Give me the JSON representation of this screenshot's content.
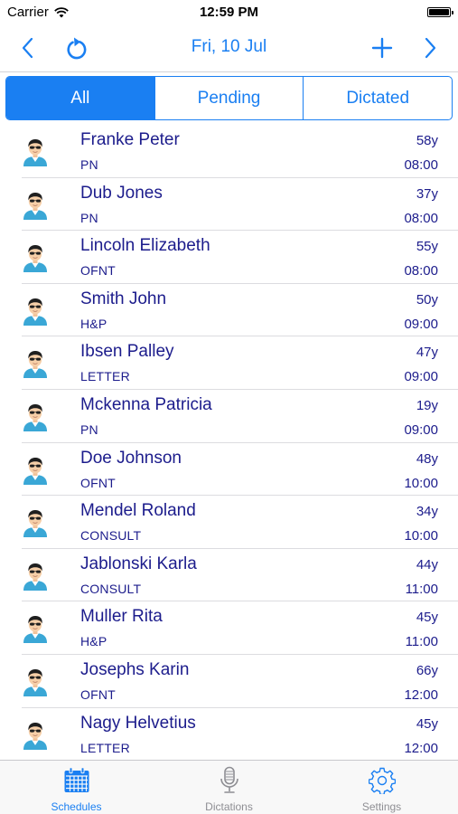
{
  "status_bar": {
    "carrier": "Carrier",
    "time": "12:59 PM"
  },
  "nav": {
    "title": "Fri, 10 Jul",
    "accent_color": "#1a7ff2"
  },
  "segments": [
    {
      "label": "All",
      "active": true
    },
    {
      "label": "Pending",
      "active": false
    },
    {
      "label": "Dictated",
      "active": false
    }
  ],
  "patients": [
    {
      "name": "Franke Peter",
      "type": "PN",
      "age": "58y",
      "time": "08:00"
    },
    {
      "name": "Dub Jones",
      "type": "PN",
      "age": "37y",
      "time": "08:00"
    },
    {
      "name": "Lincoln Elizabeth",
      "type": "OFNT",
      "age": "55y",
      "time": "08:00"
    },
    {
      "name": "Smith John",
      "type": "H&P",
      "age": "50y",
      "time": "09:00"
    },
    {
      "name": "Ibsen Palley",
      "type": "LETTER",
      "age": "47y",
      "time": "09:00"
    },
    {
      "name": "Mckenna Patricia",
      "type": "PN",
      "age": "19y",
      "time": "09:00"
    },
    {
      "name": "Doe Johnson",
      "type": "OFNT",
      "age": "48y",
      "time": "10:00"
    },
    {
      "name": "Mendel Roland",
      "type": "CONSULT",
      "age": "34y",
      "time": "10:00"
    },
    {
      "name": "Jablonski Karla",
      "type": "CONSULT",
      "age": "44y",
      "time": "11:00"
    },
    {
      "name": "Muller Rita",
      "type": "H&P",
      "age": "45y",
      "time": "11:00"
    },
    {
      "name": "Josephs Karin",
      "type": "OFNT",
      "age": "66y",
      "time": "12:00"
    },
    {
      "name": "Nagy Helvetius",
      "type": "LETTER",
      "age": "45y",
      "time": "12:00"
    }
  ],
  "tabs": [
    {
      "label": "Schedules",
      "icon": "calendar-icon",
      "active": true
    },
    {
      "label": "Dictations",
      "icon": "microphone-icon",
      "active": false
    },
    {
      "label": "Settings",
      "icon": "gear-icon",
      "active": false
    }
  ]
}
